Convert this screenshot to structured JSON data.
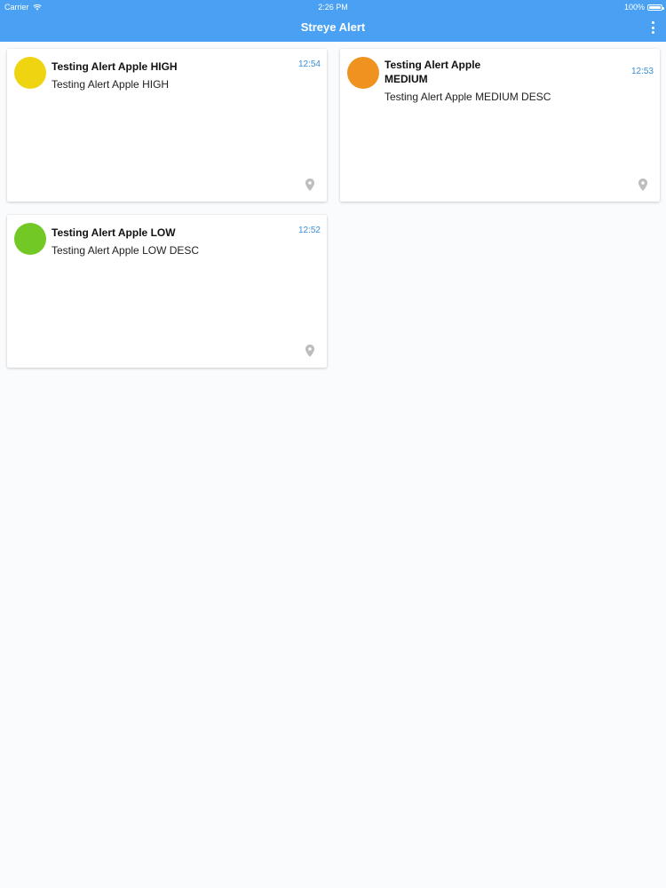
{
  "status_bar": {
    "carrier": "Carrier",
    "time": "2:26 PM",
    "battery": "100%",
    "battery_level": 1.0
  },
  "app_bar": {
    "title": "Streye Alert"
  },
  "alerts": [
    {
      "title": "Testing Alert Apple HIGH",
      "description": "Testing Alert Apple HIGH",
      "time": "12:54",
      "color": "#efd412",
      "icon": "map-pin-icon"
    },
    {
      "title": "Testing Alert Apple MEDIUM",
      "description": "Testing Alert Apple MEDIUM DESC",
      "time": "12:53",
      "color": "#f0921f",
      "icon": "map-pin-icon"
    },
    {
      "title": "Testing Alert Apple LOW",
      "description": "Testing Alert Apple LOW DESC",
      "time": "12:52",
      "color": "#72c925",
      "icon": "map-pin-icon"
    }
  ],
  "colors": {
    "accent": "#4aa1f3",
    "time_text": "#3a8fd8",
    "pin": "#bdbdbd"
  }
}
